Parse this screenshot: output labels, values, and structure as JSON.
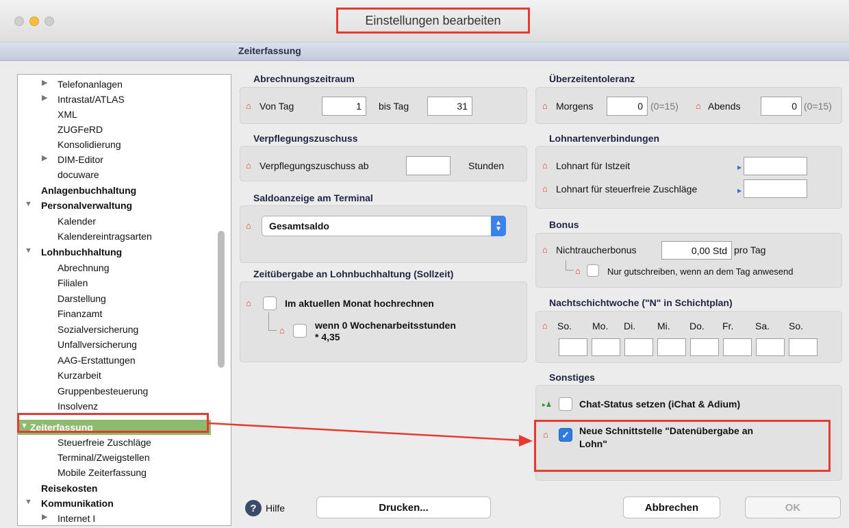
{
  "window": {
    "title": "Einstellungen bearbeiten"
  },
  "section": {
    "title": "Zeiterfassung"
  },
  "sidebar": {
    "items": [
      {
        "label": "Telefonanlagen"
      },
      {
        "label": "Intrastat/ATLAS"
      },
      {
        "label": "XML"
      },
      {
        "label": "ZUGFeRD"
      },
      {
        "label": "Konsolidierung"
      },
      {
        "label": "DIM-Editor"
      },
      {
        "label": "docuware"
      },
      {
        "label": "Anlagenbuchhaltung"
      },
      {
        "label": "Personalverwaltung"
      },
      {
        "label": "Kalender"
      },
      {
        "label": "Kalendereintragsarten"
      },
      {
        "label": "Lohnbuchhaltung"
      },
      {
        "label": "Abrechnung"
      },
      {
        "label": "Filialen"
      },
      {
        "label": "Darstellung"
      },
      {
        "label": "Finanzamt"
      },
      {
        "label": "Sozialversicherung"
      },
      {
        "label": "Unfallversicherung"
      },
      {
        "label": "AAG-Erstattungen"
      },
      {
        "label": "Kurzarbeit"
      },
      {
        "label": "Gruppenbesteuerung"
      },
      {
        "label": "Insolvenz"
      },
      {
        "label": "Zeiterfassung"
      },
      {
        "label": "Steuerfreie Zuschläge"
      },
      {
        "label": "Terminal/Zweigstellen"
      },
      {
        "label": "Mobile Zeiterfassung"
      },
      {
        "label": "Reisekosten"
      },
      {
        "label": "Kommunikation"
      },
      {
        "label": "Internet I"
      }
    ]
  },
  "abrechnung": {
    "heading": "Abrechnungszeitraum",
    "von_label": "Von Tag",
    "von_value": "1",
    "bis_label": "bis Tag",
    "bis_value": "31"
  },
  "verpflegung": {
    "heading": "Verpflegungszuschuss",
    "label": "Verpflegungszuschuss ab",
    "value": "",
    "unit": "Stunden"
  },
  "saldo": {
    "heading": "Saldoanzeige am Terminal",
    "selected": "Gesamtsaldo"
  },
  "zeituebergabe": {
    "heading": "Zeitübergabe an Lohnbuchhaltung (Sollzeit)",
    "cb1_label": "Im aktuellen Monat hochrechnen",
    "cb1_checked": false,
    "cb2_label_line1": "wenn 0 Wochenarbeitsstunden",
    "cb2_label_line2": "* 4,35",
    "cb2_checked": false
  },
  "ueberzeit": {
    "heading": "Überzeitentoleranz",
    "morgens_label": "Morgens",
    "morgens_value": "0",
    "morgens_hint": "(0=15)",
    "abends_label": "Abends",
    "abends_value": "0",
    "abends_hint": "(0=15)"
  },
  "lohnarten": {
    "heading": "Lohnartenverbindungen",
    "istzeit_label": "Lohnart für Istzeit",
    "istzeit_value": "",
    "zuschlaege_label": "Lohnart für steuerfreie Zuschläge",
    "zuschlaege_value": ""
  },
  "bonus": {
    "heading": "Bonus",
    "label": "Nichtraucherbonus",
    "value": "0,00 Std",
    "unit": "pro Tag",
    "cb_label": "Nur gutschreiben, wenn an dem Tag anwesend",
    "cb_checked": false
  },
  "nachtschicht": {
    "heading": "Nachtschichtwoche (\"N\" in Schichtplan)",
    "days": [
      "So.",
      "Mo.",
      "Di.",
      "Mi.",
      "Do.",
      "Fr.",
      "Sa.",
      "So."
    ]
  },
  "sonstiges": {
    "heading": "Sonstiges",
    "chat_label": "Chat-Status setzen (iChat & Adium)",
    "chat_checked": false,
    "schnitt_label_line1": "Neue Schnittstelle \"Datenübergabe an",
    "schnitt_label_line2": "Lohn\"",
    "schnitt_checked": true
  },
  "footer": {
    "help": "Hilfe",
    "print": "Drucken...",
    "cancel": "Abbrechen",
    "ok": "OK"
  },
  "colors": {
    "highlight": "#e63a30",
    "selection": "#8dbb6d",
    "accent": "#2f7be0"
  },
  "icons": {
    "house": "house-icon",
    "help": "question-icon",
    "arrow": "arrow-icon"
  }
}
